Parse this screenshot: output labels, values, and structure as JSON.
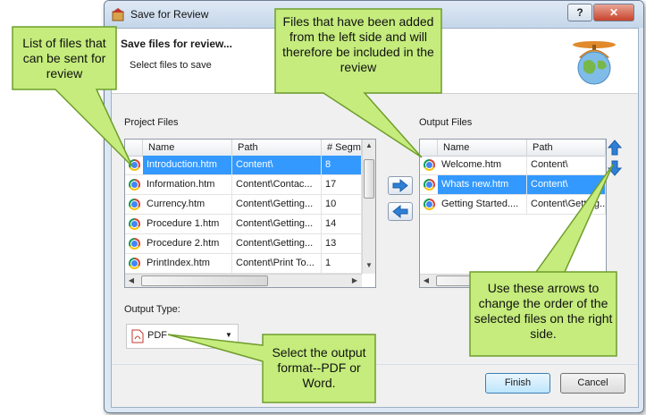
{
  "window": {
    "title": "Save for Review",
    "help_label": "?",
    "close_label": "✕"
  },
  "header": {
    "title": "Save files for review...",
    "subtitle": "Select files to save"
  },
  "project_files": {
    "label": "Project Files",
    "columns": [
      "Name",
      "Path",
      "# Segm"
    ],
    "rows": [
      {
        "name": "Introduction.htm",
        "path": "Content\\",
        "segments": "8",
        "selected": true
      },
      {
        "name": "Information.htm",
        "path": "Content\\Contac...",
        "segments": "17",
        "selected": false
      },
      {
        "name": "Currency.htm",
        "path": "Content\\Getting...",
        "segments": "10",
        "selected": false
      },
      {
        "name": "Procedure 1.htm",
        "path": "Content\\Getting...",
        "segments": "14",
        "selected": false
      },
      {
        "name": "Procedure 2.htm",
        "path": "Content\\Getting...",
        "segments": "13",
        "selected": false
      },
      {
        "name": "PrintIndex.htm",
        "path": "Content\\Print To...",
        "segments": "1",
        "selected": false
      }
    ]
  },
  "output_files": {
    "label": "Output Files",
    "columns": [
      "Name",
      "Path"
    ],
    "rows": [
      {
        "name": "Welcome.htm",
        "path": "Content\\",
        "selected": false
      },
      {
        "name": "Whats new.htm",
        "path": "Content\\",
        "selected": true
      },
      {
        "name": "Getting Started....",
        "path": "Content\\Getting...",
        "selected": false
      }
    ]
  },
  "output_type": {
    "label": "Output Type:",
    "value": "PDF"
  },
  "buttons": {
    "finish": "Finish",
    "cancel": "Cancel"
  },
  "callouts": {
    "left": "List of files that can be sent for review",
    "top": "Files that have been added from the left side and will therefore be included in the review",
    "right": "Use these arrows to change the order of the selected files on the right side.",
    "bottom": "Select the output format--PDF or Word."
  },
  "colors": {
    "callout_fill": "#c5ec7c",
    "selection": "#3399ff",
    "arrow_blue": "#2f7fd6"
  },
  "icons": {
    "file": "chrome-icon",
    "move_right": "arrow-right-icon",
    "move_left": "arrow-left-icon",
    "move_up": "arrow-up-icon",
    "move_down": "arrow-down-icon",
    "pdf": "pdf-icon"
  }
}
